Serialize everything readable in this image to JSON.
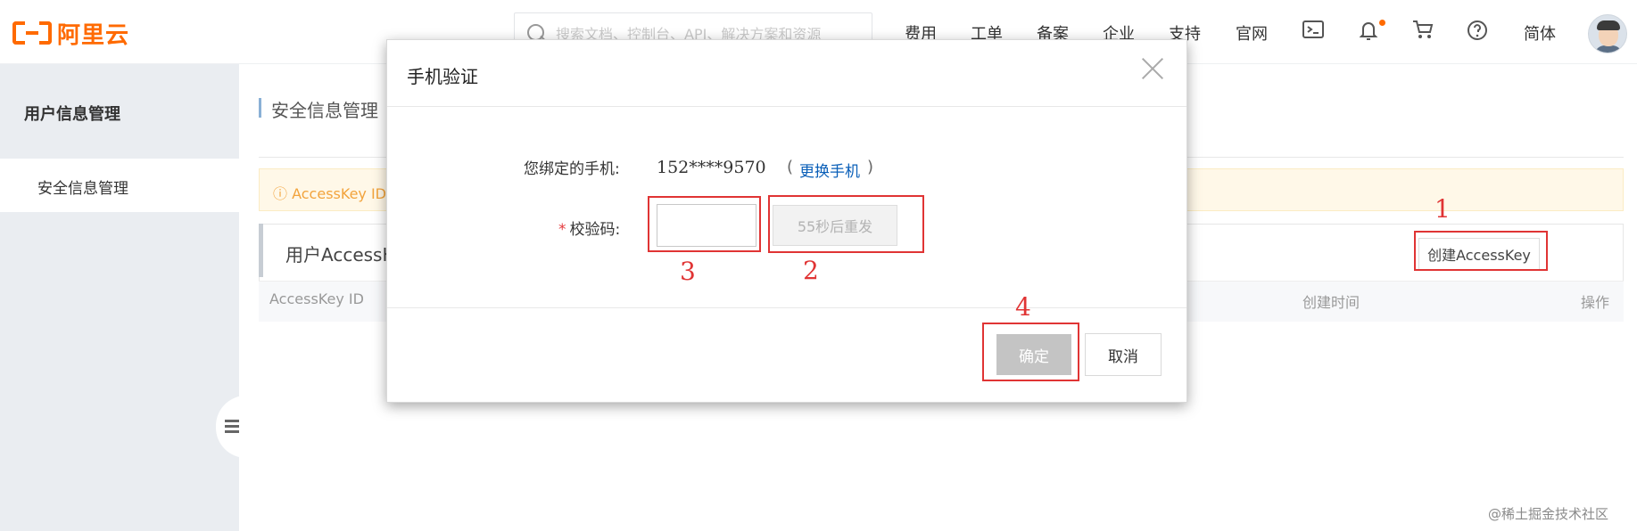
{
  "header": {
    "logo_text": "阿里云",
    "search_placeholder": "搜索文档、控制台、API、解决方案和资源",
    "nav": [
      "费用",
      "工单",
      "备案",
      "企业",
      "支持",
      "官网"
    ],
    "language": "简体",
    "icons": [
      "terminal-icon",
      "bell-icon",
      "cart-icon",
      "help-icon"
    ]
  },
  "sidebar": {
    "section_title": "用户信息管理",
    "items": [
      {
        "label": "安全信息管理"
      }
    ]
  },
  "main": {
    "page_title": "安全信息管理",
    "notice_text": "AccessKey ID",
    "panel_title": "用户AccessKey",
    "create_button": "创建AccessKey",
    "table_columns": [
      "AccessKey ID",
      "创建时间",
      "操作"
    ]
  },
  "modal": {
    "title": "手机验证",
    "phone_label": "您绑定的手机:",
    "phone_value": "152****9570",
    "change_phone": "更换手机",
    "code_label": "校验码:",
    "code_value": "",
    "resend_label": "55秒后重发",
    "ok_label": "确定",
    "cancel_label": "取消"
  },
  "annotations": [
    "1",
    "2",
    "3",
    "4"
  ],
  "watermark": "@稀土掘金技术社区",
  "colors": {
    "brand": "#ff6a00",
    "link": "#0a5fb8",
    "annotation": "#e03434"
  }
}
